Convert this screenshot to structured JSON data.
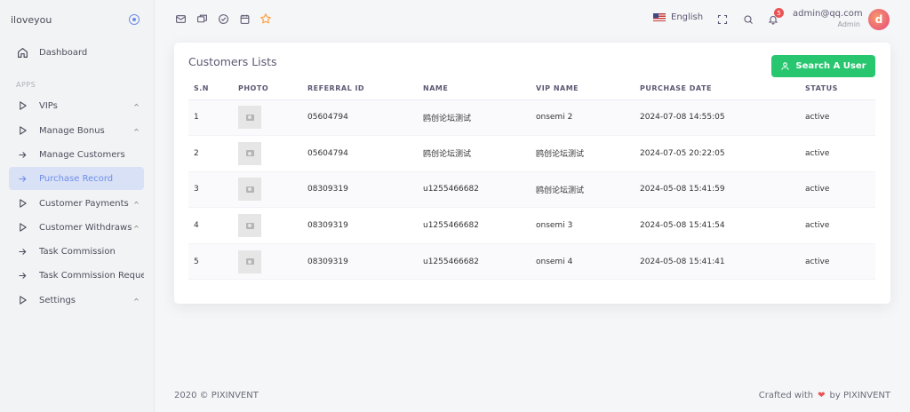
{
  "brand": {
    "name": "iloveyou"
  },
  "sidebar": {
    "dashboard": "Dashboard",
    "section": "APPS",
    "items": [
      {
        "label": "VIPs",
        "icon": "play-icon",
        "chevron": "up"
      },
      {
        "label": "Manage Bonus",
        "icon": "play-icon",
        "chevron": "up"
      },
      {
        "label": "Manage Customers",
        "icon": "arrow-right-icon"
      },
      {
        "label": "Purchase Record",
        "icon": "arrow-right-icon",
        "active": true
      },
      {
        "label": "Customer Payments",
        "icon": "play-icon",
        "chevron": "up"
      },
      {
        "label": "Customer Withdraws",
        "icon": "play-icon",
        "chevron": "up"
      },
      {
        "label": "Task Commission",
        "icon": "arrow-right-icon"
      },
      {
        "label": "Task Commission Request",
        "icon": "arrow-right-icon"
      },
      {
        "label": "Settings",
        "icon": "play-icon",
        "chevron": "up"
      }
    ]
  },
  "topbar": {
    "language": "English",
    "notification_count": "5",
    "user_email": "admin@qq.com",
    "user_role": "Admin"
  },
  "card": {
    "title": "Customers Lists",
    "search_button": "Search A User",
    "columns": [
      "S.N",
      "PHOTO",
      "REFERRAL ID",
      "NAME",
      "VIP NAME",
      "PURCHASE DATE",
      "STATUS"
    ],
    "rows": [
      {
        "sn": "1",
        "referral": "05604794",
        "name": "鸥创论坛测试",
        "vip": "onsemi 2",
        "date": "2024-07-08 14:55:05",
        "status": "active"
      },
      {
        "sn": "2",
        "referral": "05604794",
        "name": "鸥创论坛测试",
        "vip": "鸥创论坛测试",
        "date": "2024-07-05 20:22:05",
        "status": "active"
      },
      {
        "sn": "3",
        "referral": "08309319",
        "name": "u1255466682",
        "vip": "鸥创论坛测试",
        "date": "2024-05-08 15:41:59",
        "status": "active"
      },
      {
        "sn": "4",
        "referral": "08309319",
        "name": "u1255466682",
        "vip": "onsemi 3",
        "date": "2024-05-08 15:41:54",
        "status": "active"
      },
      {
        "sn": "5",
        "referral": "08309319",
        "name": "u1255466682",
        "vip": "onsemi 4",
        "date": "2024-05-08 15:41:41",
        "status": "active"
      }
    ]
  },
  "footer": {
    "copyright": "2020 © PIXINVENT",
    "crafted": "Crafted with",
    "by": "by PIXINVENT"
  },
  "colors": {
    "accent": "#6e8ee8",
    "success": "#28c76f",
    "danger": "#ea5455"
  }
}
